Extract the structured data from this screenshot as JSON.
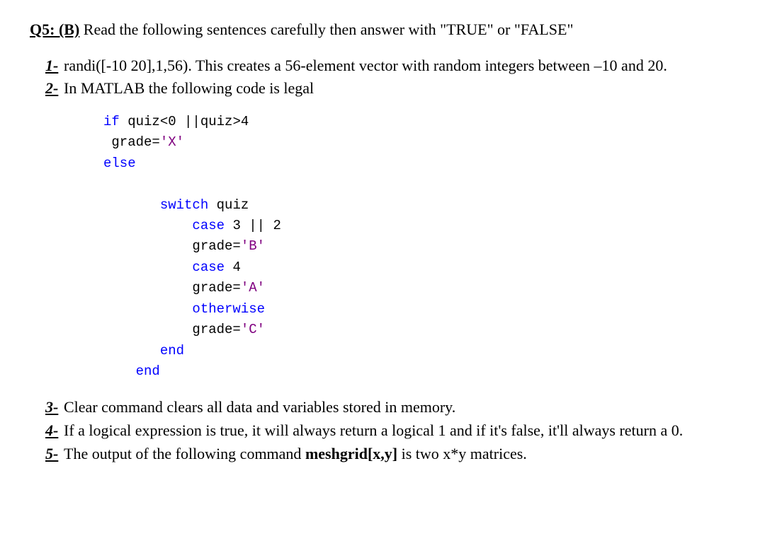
{
  "header": {
    "label": "Q5: (B)",
    "instruction": " Read the following sentences carefully then answer with \"TRUE\" or \"FALSE\""
  },
  "items": [
    {
      "bullet": "1-",
      "text": "randi([-10 20],1,56). This creates a 56-element vector with random integers between –10 and 20."
    },
    {
      "bullet": "2-",
      "text": "In MATLAB the following code is legal"
    },
    {
      "bullet": "3-",
      "text": "Clear command clears all data and variables stored in memory."
    },
    {
      "bullet": "4-",
      "text": "If a logical expression is true, it will always return a logical 1 and if it's false, it'll always return a 0."
    },
    {
      "bullet": "5-",
      "text_before": "The output of the following command  ",
      "bold": "meshgrid[x,y]",
      "text_after": "  is two x*y matrices."
    }
  ],
  "code": {
    "l1_a": "if ",
    "l1_b": "quiz<0 ||quiz>4",
    "l2_a": " grade=",
    "l2_b": "'X'",
    "l3": "else",
    "l4_a": "       switch ",
    "l4_b": "quiz",
    "l5_a": "           case ",
    "l5_b": "3 || 2",
    "l6_a": "           grade=",
    "l6_b": "'B'",
    "l7_a": "           case ",
    "l7_b": "4",
    "l8_a": "           grade=",
    "l8_b": "'A'",
    "l9": "           otherwise",
    "l10_a": "           grade=",
    "l10_b": "'C'",
    "l11": "       end",
    "l12": "    end"
  }
}
